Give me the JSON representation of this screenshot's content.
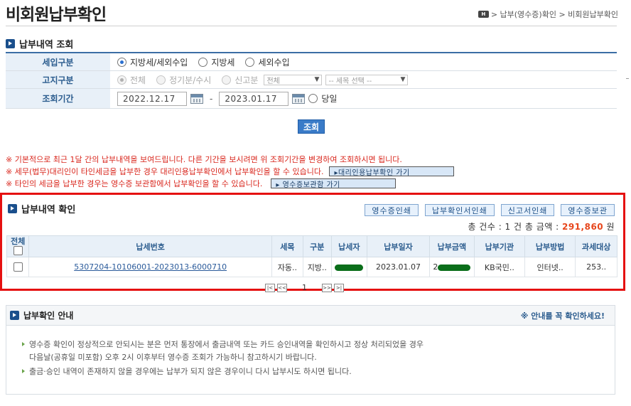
{
  "page": {
    "title": "비회원납부확인",
    "breadcrumb": {
      "home_icon": "home-icon",
      "home_label": "H",
      "trail": "> 납부(영수증)확인 > 비회원납부확인"
    }
  },
  "search": {
    "section_title": "납부내역 조회",
    "rows": [
      {
        "label": "세입구분",
        "options": [
          "지방세/세외수입",
          "지방세",
          "세외수입"
        ],
        "selected": "지방세/세외수입"
      },
      {
        "label": "고지구분",
        "options": [
          "전체",
          "정기분/수시",
          "신고분"
        ],
        "selected": "전체",
        "select1": "전체",
        "select2": "-- 세목 선택 --"
      },
      {
        "label": "조회기간",
        "start": "2022.12.17",
        "end": "2023.01.17",
        "today_label": "당일"
      }
    ],
    "submit_label": "조회"
  },
  "notices": [
    {
      "text": "※ 기본적으로 최근 1달 간의 납부내역을 보여드립니다. 다른 기간을 보시려면 위 조회기간을 변경하여 조회하시면 됩니다."
    },
    {
      "text": "※ 세무(법무)대리인이 타인세금을 납부한 경우 대리인용납부확인에서 납부확인을 할 수 있습니다.",
      "button": "▸대리인용납부확인 가기"
    },
    {
      "text": "※ 타인의 세금을 납부한 경우는 영수증 보관함에서 납부확인을 할 수 있습니다.",
      "button": "▸ 영수증보관함 가기"
    }
  ],
  "results": {
    "section_title": "납부내역 확인",
    "buttons": [
      "영수증인쇄",
      "납부확인서인쇄",
      "신고서인쇄",
      "영수증보관"
    ],
    "summary_prefix": "총 건수 : 1 건 총 금액 : ",
    "summary_amount": "291,860",
    "summary_unit": " 원",
    "columns": [
      "전체",
      "납세번호",
      "세목",
      "구분",
      "납세자",
      "납부일자",
      "납부금액",
      "납부기관",
      "납부방법",
      "과세대상"
    ],
    "rows": [
      {
        "tax_no": "5307204-10106001-2023013-6000710",
        "item": "자동..",
        "type": "지방..",
        "payer": "",
        "date": "2023.01.07",
        "amount_prefix": "2",
        "agency": "KB국민..",
        "method": "인터넷..",
        "target": "253.."
      }
    ],
    "pager": {
      "first": "|<",
      "prev": "<<",
      "current": "1",
      "next": ">>",
      "last": ">|"
    }
  },
  "guide": {
    "title": "납부확인 안내",
    "note": "※ 안내를 꼭 확인하세요!",
    "items": [
      "영수증 확인이 정상적으로 안되시는 분은 먼저 통장에서 출금내역 또는 카드 승인내역을 확인하시고 정상 처리되었을 경우",
      "다음날(공휴일 미포함) 오후 2시 이후부터 영수증 조회가 가능하니 참고하시기 바랍니다.",
      "출금·승인 내역이 존재하지 않을 경우에는 납부가 되지 않은 경우이니 다시 납부시도 하시면 됩니다."
    ]
  },
  "colors": {
    "accent": "#3a7bc8",
    "header_bg": "#e8f0f8",
    "notice_red": "#d9261c",
    "highlight_border": "#e51010",
    "amount": "#e7461c"
  },
  "icons": [
    "home-icon",
    "section-arrow-icon",
    "calendar-icon",
    "checkbox-icon",
    "radio-icon",
    "guide-bullet-icon"
  ]
}
